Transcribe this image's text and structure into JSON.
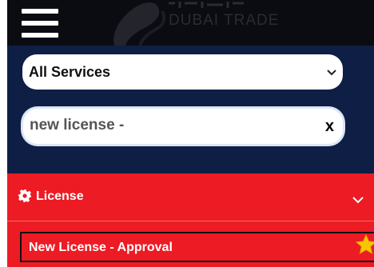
{
  "header": {
    "logo_text": "DUBAI TRADE"
  },
  "filters": {
    "service_select": {
      "selected": "All Services"
    },
    "search": {
      "value": "new license -",
      "clear_label": "x"
    }
  },
  "results": {
    "category": {
      "label": "License",
      "icon": "gear-icon",
      "expand_icon": "chevron-down-icon"
    },
    "items": [
      {
        "label": "New License - Approval",
        "icon": "star-icon"
      }
    ]
  },
  "colors": {
    "header_bg": "#0b0b12",
    "panel_bg": "#0f1e45",
    "accent_red": "#ed1b24",
    "star": "#f7c600"
  }
}
